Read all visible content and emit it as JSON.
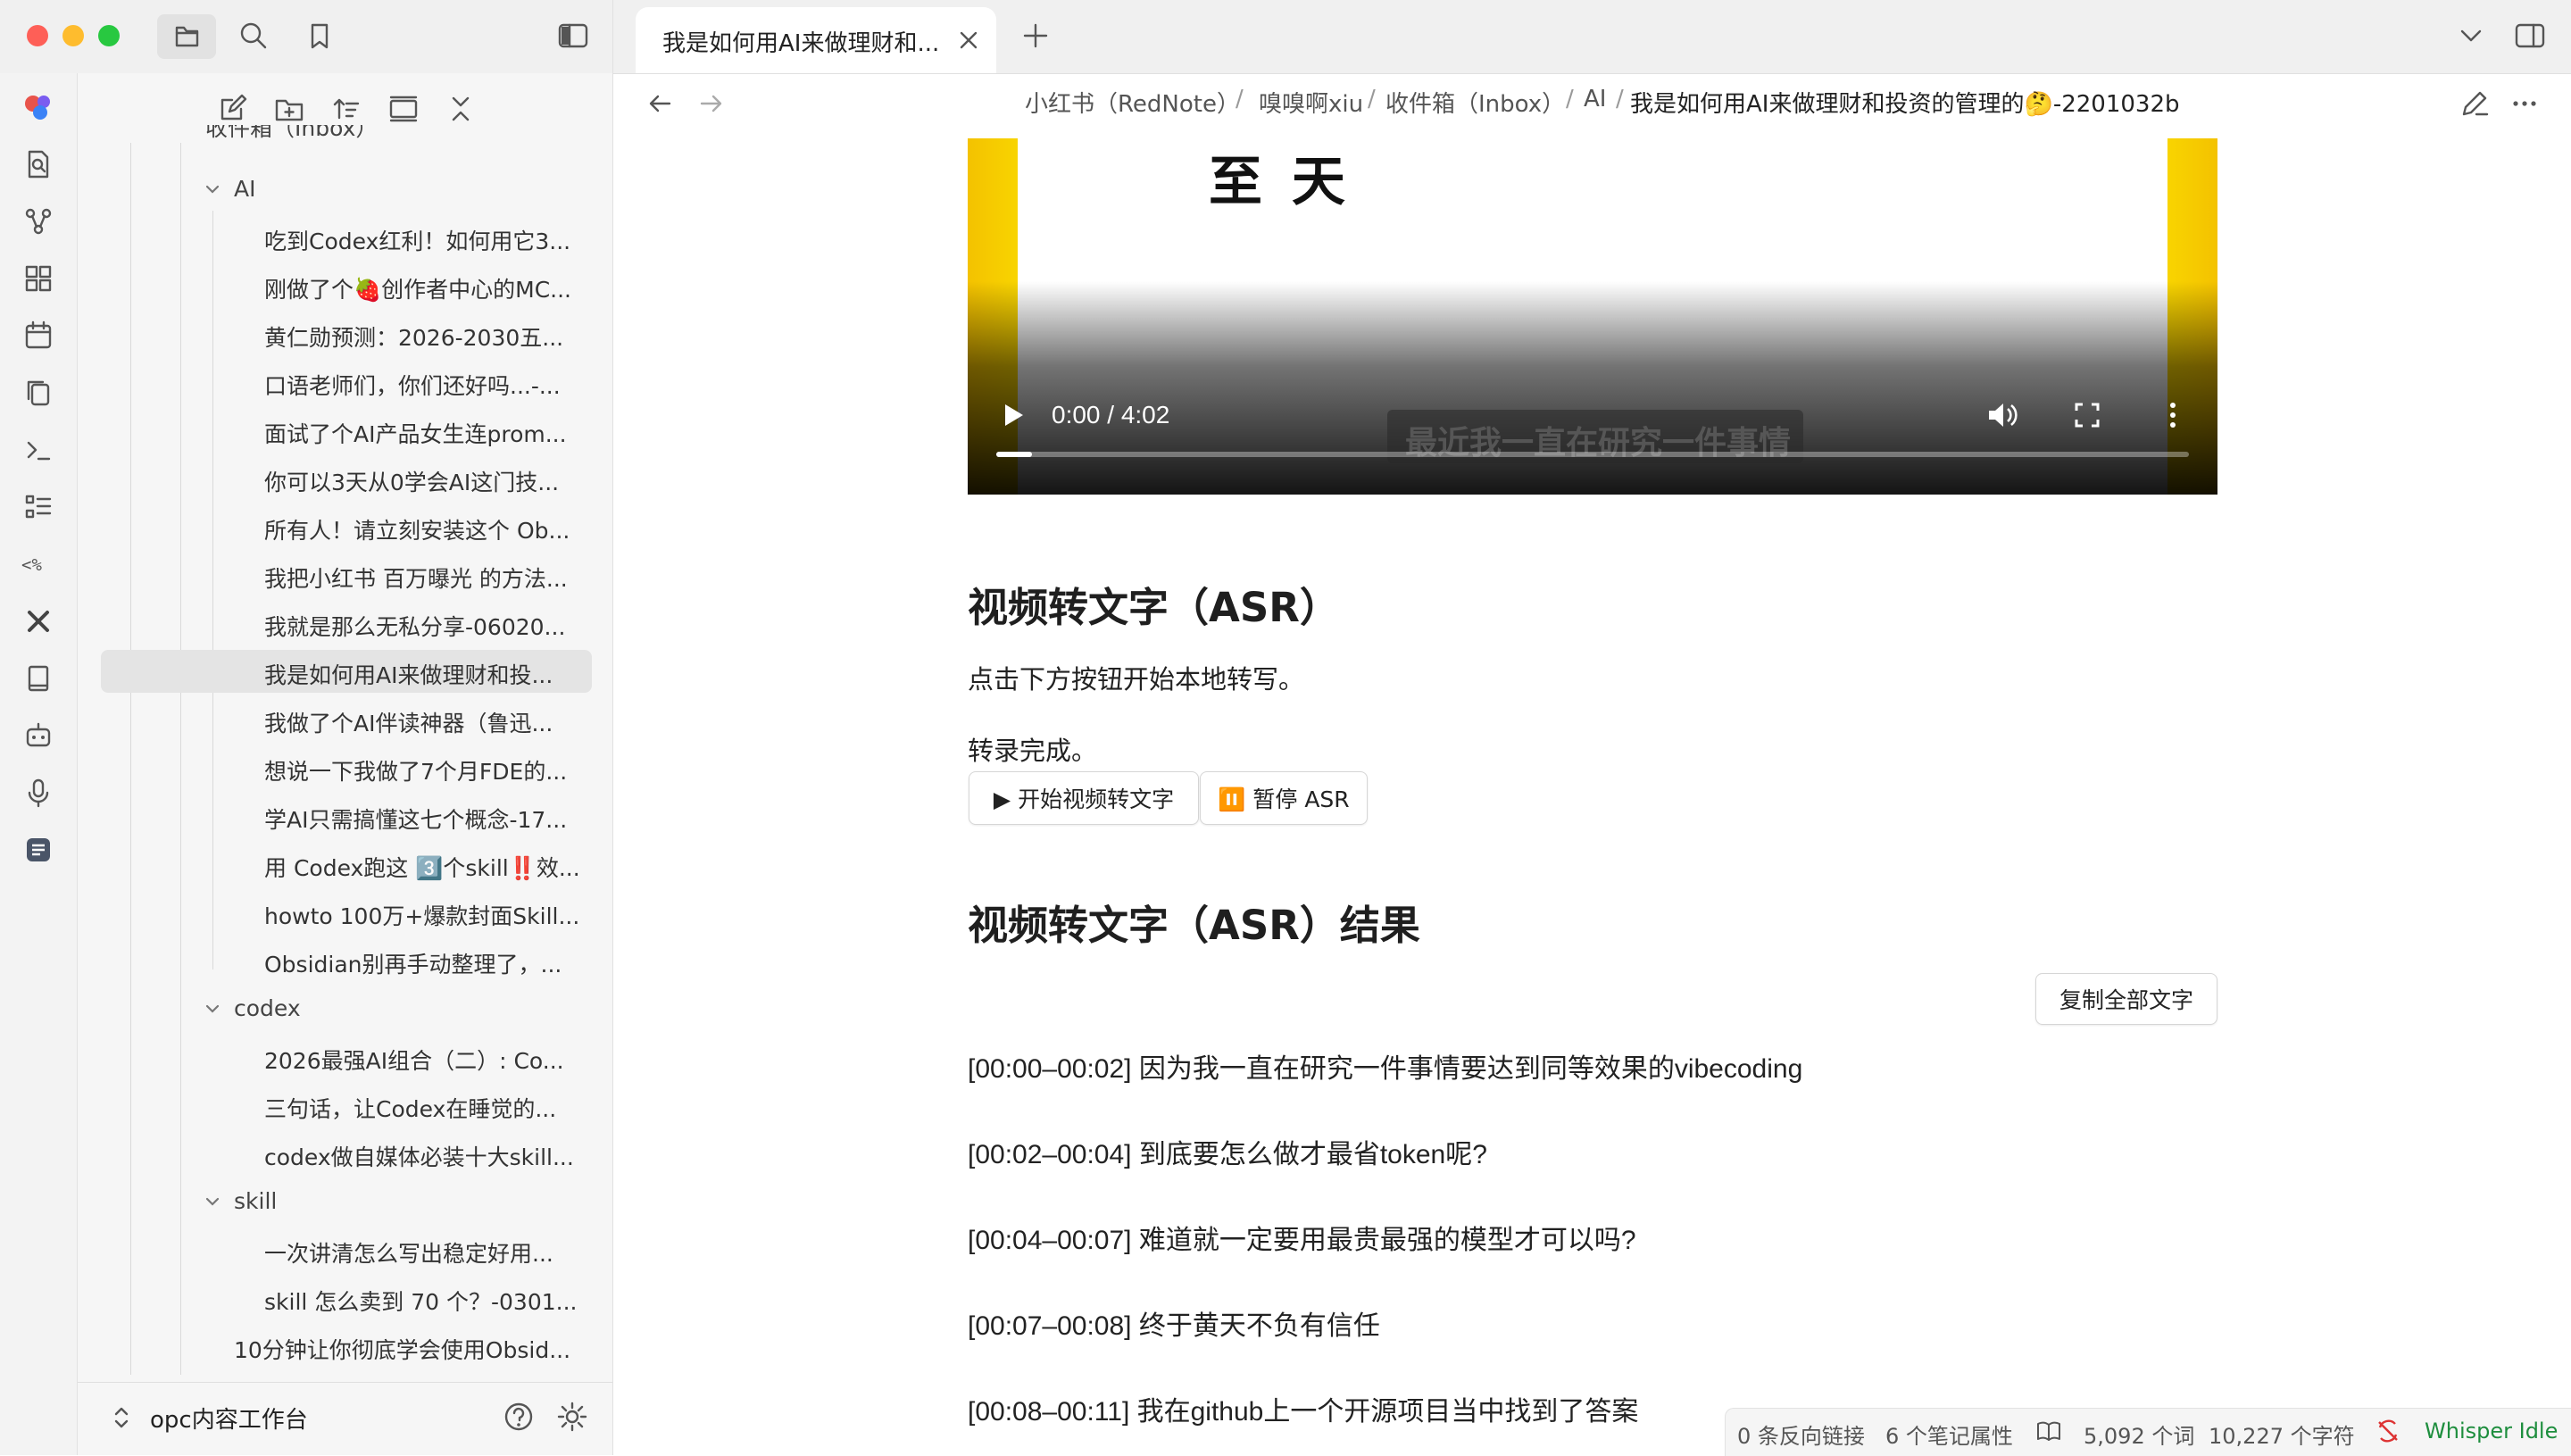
{
  "tab": {
    "title": "我是如何用AI来做理财和..."
  },
  "breadcrumb": [
    "小红书（RedNote）",
    "嗅嗅啊xiu",
    "收件箱（Inbox）",
    "AI",
    "我是如何用AI来做理财和投资的管理的🤔-2201032b"
  ],
  "sidebar": {
    "partial_top": "收件箱（Inbox）",
    "folders": {
      "ai": "AI",
      "codex": "codex",
      "skill": "skill"
    },
    "ai_files": [
      "吃到Codex红利！如何用它3...",
      "刚做了个🍓创作者中心的MC...",
      "黄仁勋预测：2026-2030五...",
      "口语老师们，你们还好吗...-...",
      "面试了个AI产品女生连prom...",
      "你可以3天从0学会AI这门技...",
      "所有人！请立刻安装这个 Ob...",
      "我把小红书 百万曝光 的方法...",
      "我就是那么无私分享-06020...",
      "我是如何用AI来做理财和投...",
      "我做了个AI伴读神器（鲁迅...",
      "想说一下我做了7个月FDE的...",
      "学AI只需搞懂这七个概念-17...",
      "用 Codex跑这 3️⃣个skill‼️效...",
      "howto 100万+爆款封面Skill...",
      "Obsidian别再手动整理了，..."
    ],
    "codex_files": [
      "2026最强AI组合（二）: Co...",
      "三句话，让Codex在睡觉的...",
      "codex做自媒体必装十大skill..."
    ],
    "skill_files": [
      "一次讲清怎么写出稳定好用...",
      "skill 怎么卖到 70 个？-0301..."
    ],
    "root_file": "10分钟让你彻底学会使用Obsid...",
    "vault_name": "opc内容工作台"
  },
  "video": {
    "time": "0:00 / 4:02",
    "caption": "最近我一直在研究一件事情",
    "top_text": "至 天",
    "progress": 0.0
  },
  "asr": {
    "heading": "视频转文字（ASR）",
    "instruction": "点击下方按钮开始本地转写。",
    "status": "转录完成。",
    "start_btn": "▶ 开始视频转文字",
    "pause_btn": "⏸️ 暂停 ASR",
    "result_heading": "视频转文字（ASR）结果",
    "copy_btn": "复制全部文字",
    "lines": [
      "[00:00–00:02] 因为我一直在研究一件事情要达到同等效果的vibecoding",
      "[00:02–00:04] 到底要怎么做才最省token呢?",
      "[00:04–00:07] 难道就一定要用最贵最强的模型才可以吗?",
      "[00:07–00:08] 终于黄天不负有信任",
      "[00:08–00:11] 我在github上一个开源项目当中找到了答案"
    ]
  },
  "status": {
    "backlinks": "0 条反向链接",
    "properties": "6 个笔记属性",
    "words": "5,092 个词",
    "chars": "10,227 个字符",
    "whisper": "Whisper Idle"
  },
  "colors": {
    "accent_yellow": "#f5c400",
    "whisper_green": "#1e8e3e",
    "active_row": "#e4e4e4"
  }
}
